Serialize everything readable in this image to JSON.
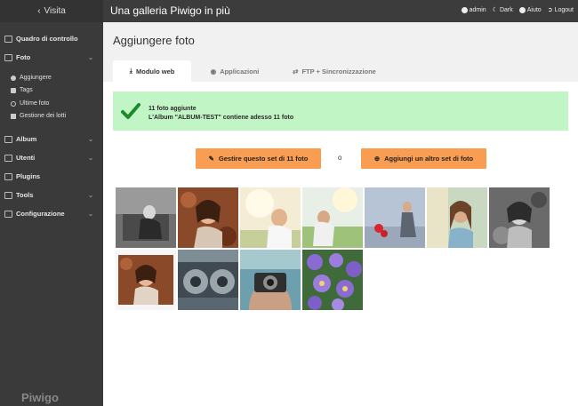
{
  "topbar": {
    "back_label": "Visita",
    "gallery_title": "Una galleria Piwigo in più",
    "user": "admin",
    "theme": "Dark",
    "help": "Aiuto",
    "logout": "Logout"
  },
  "sidebar": {
    "items": [
      {
        "label": "Quadro di controllo",
        "icon": "monitor-icon"
      },
      {
        "label": "Foto",
        "icon": "image-icon"
      },
      {
        "label": "Album",
        "icon": "album-icon"
      },
      {
        "label": "Utenti",
        "icon": "users-icon"
      },
      {
        "label": "Plugins",
        "icon": "puzzle-icon"
      },
      {
        "label": "Tools",
        "icon": "wrench-icon"
      },
      {
        "label": "Configurazione",
        "icon": "gear-icon"
      }
    ],
    "photo_sub": [
      {
        "label": "Aggiungere",
        "icon": "plus-circle-icon"
      },
      {
        "label": "Tags",
        "icon": "tag-icon"
      },
      {
        "label": "Ultime foto",
        "icon": "clock-icon"
      },
      {
        "label": "Gestione dei lotti",
        "icon": "grid-icon"
      }
    ],
    "logo": "Piwigo"
  },
  "main": {
    "page_title": "Aggiungere foto",
    "tabs": [
      {
        "label": "Modulo web",
        "active": true
      },
      {
        "label": "Applicazioni",
        "active": false
      },
      {
        "label": "FTP + Sincronizzazione",
        "active": false
      }
    ],
    "success_line1": "11 foto aggiunte",
    "success_line2": "L'Album \"ALBUM-TEST\" contiene adesso 11 foto",
    "manage_button": "Gestire questo set di 11 foto",
    "or_label": "o",
    "add_button": "Aggiungi un altro set di foto"
  },
  "colors": {
    "topbar": "#3c3c3c",
    "sidebar": "#3a3a3a",
    "success_bg": "#c2f5c5",
    "success_check": "#1a8a2a",
    "button": "#f99d52"
  },
  "thumbnails": [
    {
      "subject": "woman reading, black and white"
    },
    {
      "subject": "woman lying in autumn leaves"
    },
    {
      "subject": "woman with sunlight"
    },
    {
      "subject": "woman in meadow"
    },
    {
      "subject": "woman with red balloons"
    },
    {
      "subject": "woman portrait outdoors"
    },
    {
      "subject": "woman lying, black and white"
    },
    {
      "subject": "woman lying in leaves, bordered"
    },
    {
      "subject": "turbine machinery"
    },
    {
      "subject": "woman with camera"
    },
    {
      "subject": "purple flowers"
    }
  ]
}
